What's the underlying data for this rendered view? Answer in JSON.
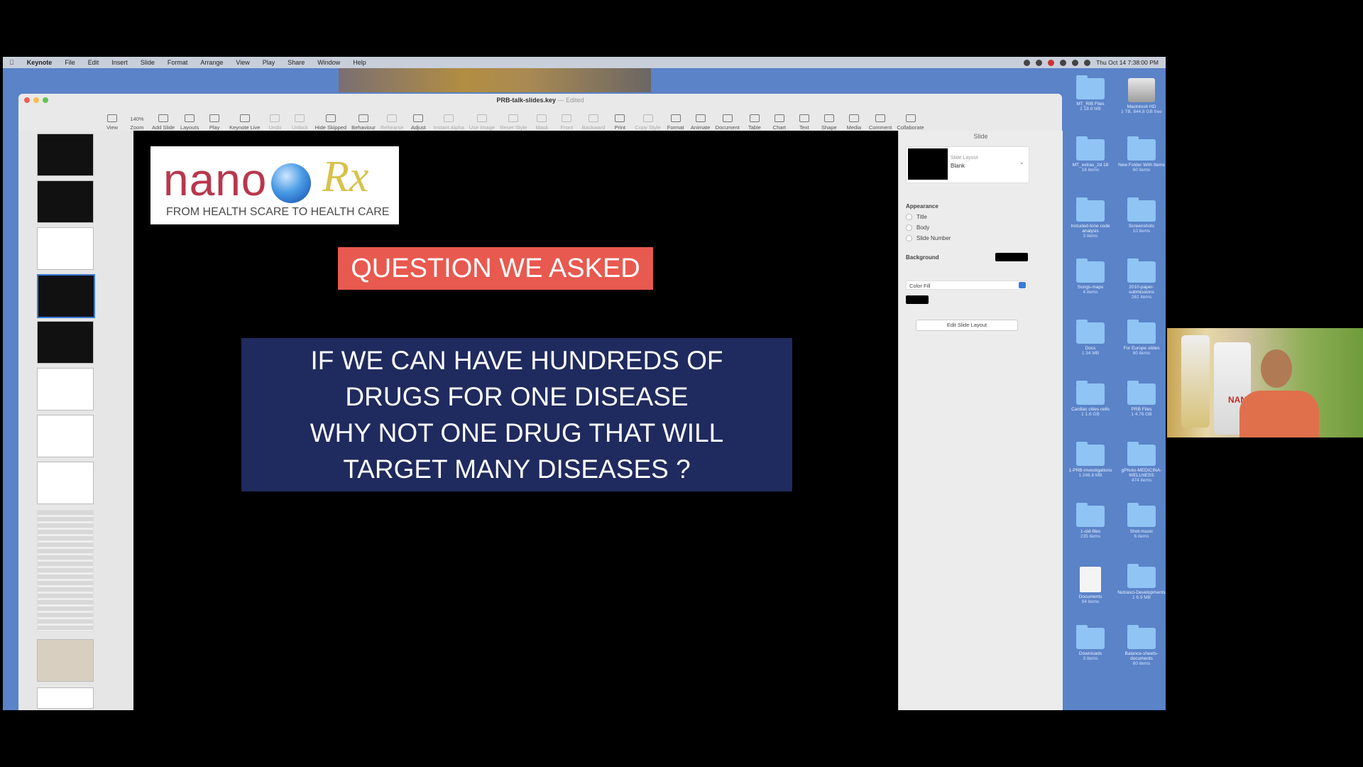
{
  "menubar": {
    "items": [
      "Keynote",
      "File",
      "Edit",
      "Insert",
      "Slide",
      "Format",
      "Arrange",
      "View",
      "Play",
      "Share",
      "Window",
      "Help"
    ],
    "clock": "Thu Oct 14 7:38:00 PM"
  },
  "window": {
    "title": "PRB-talk-slides.key",
    "subtitle": "Edited"
  },
  "toolbar": {
    "buttons": [
      "View",
      "Zoom",
      "Add Slide",
      "Layouts",
      "Play",
      "Keynote Live",
      "Undo",
      "Unlock",
      "Hide Skipped",
      "Behaviour",
      "Rehearse",
      "Adjust",
      "Instant Alpha",
      "Use Image",
      "Reset Style",
      "Mask",
      "Front",
      "Backward",
      "Print",
      "Copy Style",
      "Format",
      "Animate",
      "Document",
      "Table",
      "Chart",
      "Text",
      "Shape",
      "Media",
      "Comment",
      "Collaborate"
    ],
    "zoom_value": "140%"
  },
  "slide": {
    "logo": {
      "word": "nano",
      "rx": "Rx",
      "tagline": "FROM HEALTH SCARE TO HEALTH CARE"
    },
    "banner": "QUESTION WE ASKED",
    "question_lines": [
      "IF WE CAN HAVE HUNDREDS OF",
      "DRUGS FOR ONE DISEASE",
      "WHY NOT ONE DRUG THAT WILL",
      "TARGET MANY DISEASES ?"
    ]
  },
  "inspector": {
    "tab": "Slide",
    "layout_label": "Slide Layout",
    "layout_value": "Blank",
    "appearance": "Appearance",
    "options": [
      "Title",
      "Body",
      "Slide Number"
    ],
    "background_label": "Background",
    "fill_type": "Color Fill",
    "edit_button": "Edit Slide Layout",
    "background_color": "#000000"
  },
  "desktop": {
    "icons": [
      {
        "name": "MT_RIB Files",
        "info": "1 18.8 MB",
        "kind": "folder"
      },
      {
        "name": "Macintosh HD",
        "info": "1 TB, 844.8 GB free",
        "kind": "disk"
      },
      {
        "name": "MT_extras_2d 18",
        "info": "16 items",
        "kind": "folder"
      },
      {
        "name": "New Folder With Items",
        "info": "60 items",
        "kind": "folder"
      },
      {
        "name": "Included-tone code analysis",
        "info": "3 items",
        "kind": "folder"
      },
      {
        "name": "Screenshots",
        "info": "10 items",
        "kind": "folder"
      },
      {
        "name": "Songs-maps",
        "info": "4 items",
        "kind": "folder"
      },
      {
        "name": "2010-paper-submissions",
        "info": "261 items",
        "kind": "folder"
      },
      {
        "name": "Docs",
        "info": "1 34 MB",
        "kind": "folder"
      },
      {
        "name": "For Europe slides",
        "info": "60 items",
        "kind": "folder"
      },
      {
        "name": "Cardiac cities cells",
        "info": "1 1.6 GB",
        "kind": "folder"
      },
      {
        "name": "PRB Files",
        "info": "1 4.76 GB",
        "kind": "folder"
      },
      {
        "name": "1-PRB-Investigations",
        "info": "1 246.8 MB",
        "kind": "folder"
      },
      {
        "name": "gPhoto-MEDICINA-WELLNESS",
        "info": "474 items",
        "kind": "folder"
      },
      {
        "name": "1-old-files",
        "info": "235 items",
        "kind": "folder"
      },
      {
        "name": "Shot-music",
        "info": "6 items",
        "kind": "folder"
      },
      {
        "name": "Documents",
        "info": "94 items",
        "kind": "doc"
      },
      {
        "name": "Nutrasci-Developments",
        "info": "1 6.9 MB",
        "kind": "folder"
      },
      {
        "name": "Downloads",
        "info": "3 items",
        "kind": "folder"
      },
      {
        "name": "Balance-sheets-documents",
        "info": "60 items",
        "kind": "folder"
      }
    ]
  },
  "webcam": {
    "product_label": "NANO SOMA"
  }
}
